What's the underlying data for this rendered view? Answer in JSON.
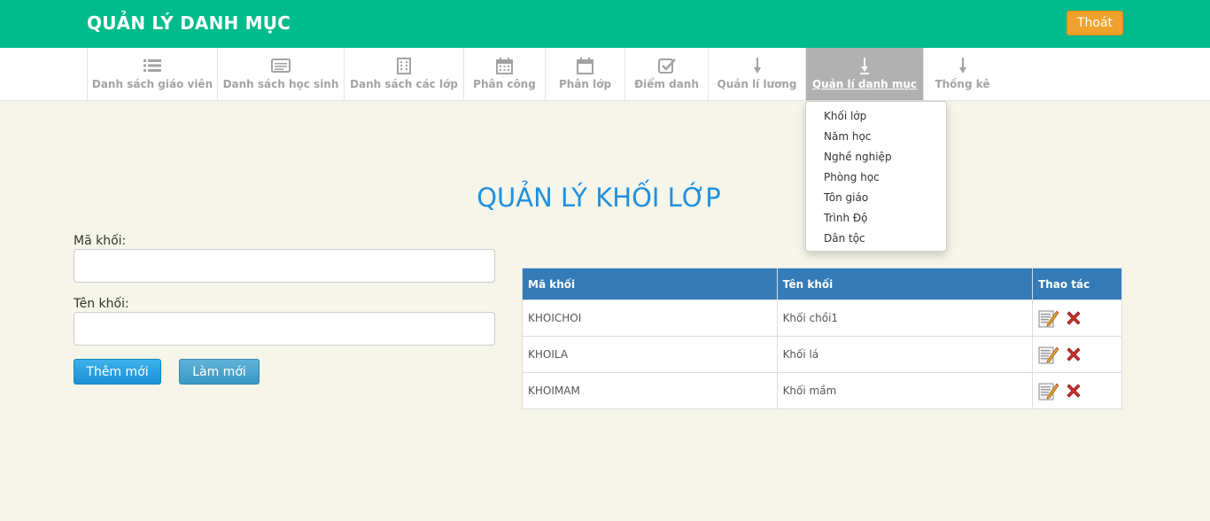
{
  "header": {
    "title": "QUẢN LÝ DANH MỤC",
    "logout_label": "Thoát"
  },
  "nav": {
    "items": [
      {
        "label": "Danh sách giáo viên",
        "icon": "list-icon"
      },
      {
        "label": "Danh sách học sinh",
        "icon": "id-card-icon"
      },
      {
        "label": "Danh sách các lớp",
        "icon": "building-icon"
      },
      {
        "label": "Phân công",
        "icon": "calendar-icon"
      },
      {
        "label": "Phân lớp",
        "icon": "calendar-blank-icon"
      },
      {
        "label": "Điểm danh",
        "icon": "checkbox-icon"
      },
      {
        "label": "Quản lí lương",
        "icon": "arrow-down-icon"
      },
      {
        "label": "Quản lí danh mục",
        "icon": "arrow-down-icon",
        "active": true
      },
      {
        "label": "Thống kê",
        "icon": "arrow-down-icon"
      }
    ]
  },
  "dropdown": {
    "items": [
      "Khối lớp",
      "Năm học",
      "Nghề nghiệp",
      "Phòng học",
      "Tôn giáo",
      "Trình Độ",
      "Dân tộc"
    ]
  },
  "page": {
    "heading": "QUẢN LÝ KHỐI LỚP"
  },
  "form": {
    "ma_khoi_label": "Mã khối:",
    "ma_khoi_value": "",
    "ten_khoi_label": "Tên khối:",
    "ten_khoi_value": "",
    "add_label": "Thêm mới",
    "reset_label": "Làm mới"
  },
  "table": {
    "headers": [
      "Mã khối",
      "Tên khối",
      "Thao tác"
    ],
    "rows": [
      {
        "ma": "KHOICHOI",
        "ten": "Khối chồi1"
      },
      {
        "ma": "KHOILA",
        "ten": "Khối lá"
      },
      {
        "ma": "KHOIMAM",
        "ten": "Khối mầm"
      }
    ]
  },
  "colors": {
    "header_bg": "#00bb8b",
    "logout_bg": "#efa22b",
    "nav_active_bg": "#b1b1b1",
    "heading_color": "#1f8fe0",
    "table_header_bg": "#347bb8",
    "page_bg": "#f5f5e9"
  }
}
